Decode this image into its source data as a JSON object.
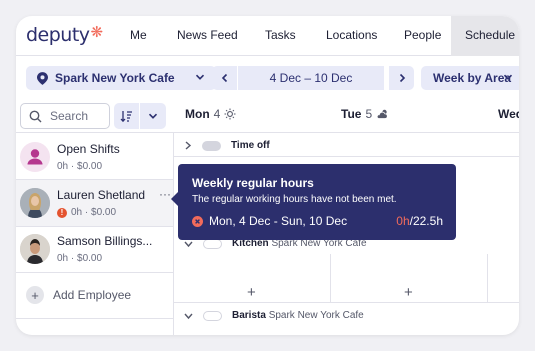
{
  "brand": {
    "name": "deputy",
    "logo_color": "#2c2f6d",
    "star_color": "#f26b5b"
  },
  "nav": {
    "items": [
      {
        "label": "Me"
      },
      {
        "label": "News Feed"
      },
      {
        "label": "Tasks"
      },
      {
        "label": "Locations"
      },
      {
        "label": "People"
      },
      {
        "label": "Schedule",
        "active": true
      }
    ]
  },
  "toolbar": {
    "location": "Spark New York Cafe",
    "date_range": "4 Dec – 10 Dec",
    "view": "Week by Area"
  },
  "search": {
    "placeholder": "Search"
  },
  "days": [
    {
      "name": "Mon",
      "num": "4",
      "weather_icon": "sun-icon"
    },
    {
      "name": "Tue",
      "num": "5",
      "weather_icon": "partly-cloudy-icon"
    },
    {
      "name": "Wed",
      "num": ""
    }
  ],
  "employees": [
    {
      "name": "Open Shifts",
      "meta": "0h · $0.00",
      "avatar": "person-icon"
    },
    {
      "name": "Lauren Shetland",
      "meta": "0h · $0.00",
      "avatar": "photo",
      "warning": true,
      "more": "···"
    },
    {
      "name": "Samson Billings...",
      "meta": "0h · $0.00",
      "avatar": "photo"
    }
  ],
  "add_employee": {
    "label": "Add Employee"
  },
  "groups": [
    {
      "name": "Time off",
      "sub": ""
    },
    {
      "name": "Kitchen",
      "sub": "Spark New York Cafe"
    },
    {
      "name": "Barista",
      "sub": "Spark New York Cafe"
    }
  ],
  "grid_add": "+",
  "tooltip": {
    "title": "Weekly regular hours",
    "description": "The regular working hours have not been met.",
    "range": "Mon, 4 Dec - Sun, 10 Dec",
    "hours_worked": "0h",
    "hours_target": "/22.5h",
    "bg_color": "#2c2f6d",
    "alert_color": "#f26b5b"
  },
  "colors": {
    "accent_bg": "#e8eaf8",
    "accent_text": "#2c3070",
    "warning": "#e4532f"
  }
}
